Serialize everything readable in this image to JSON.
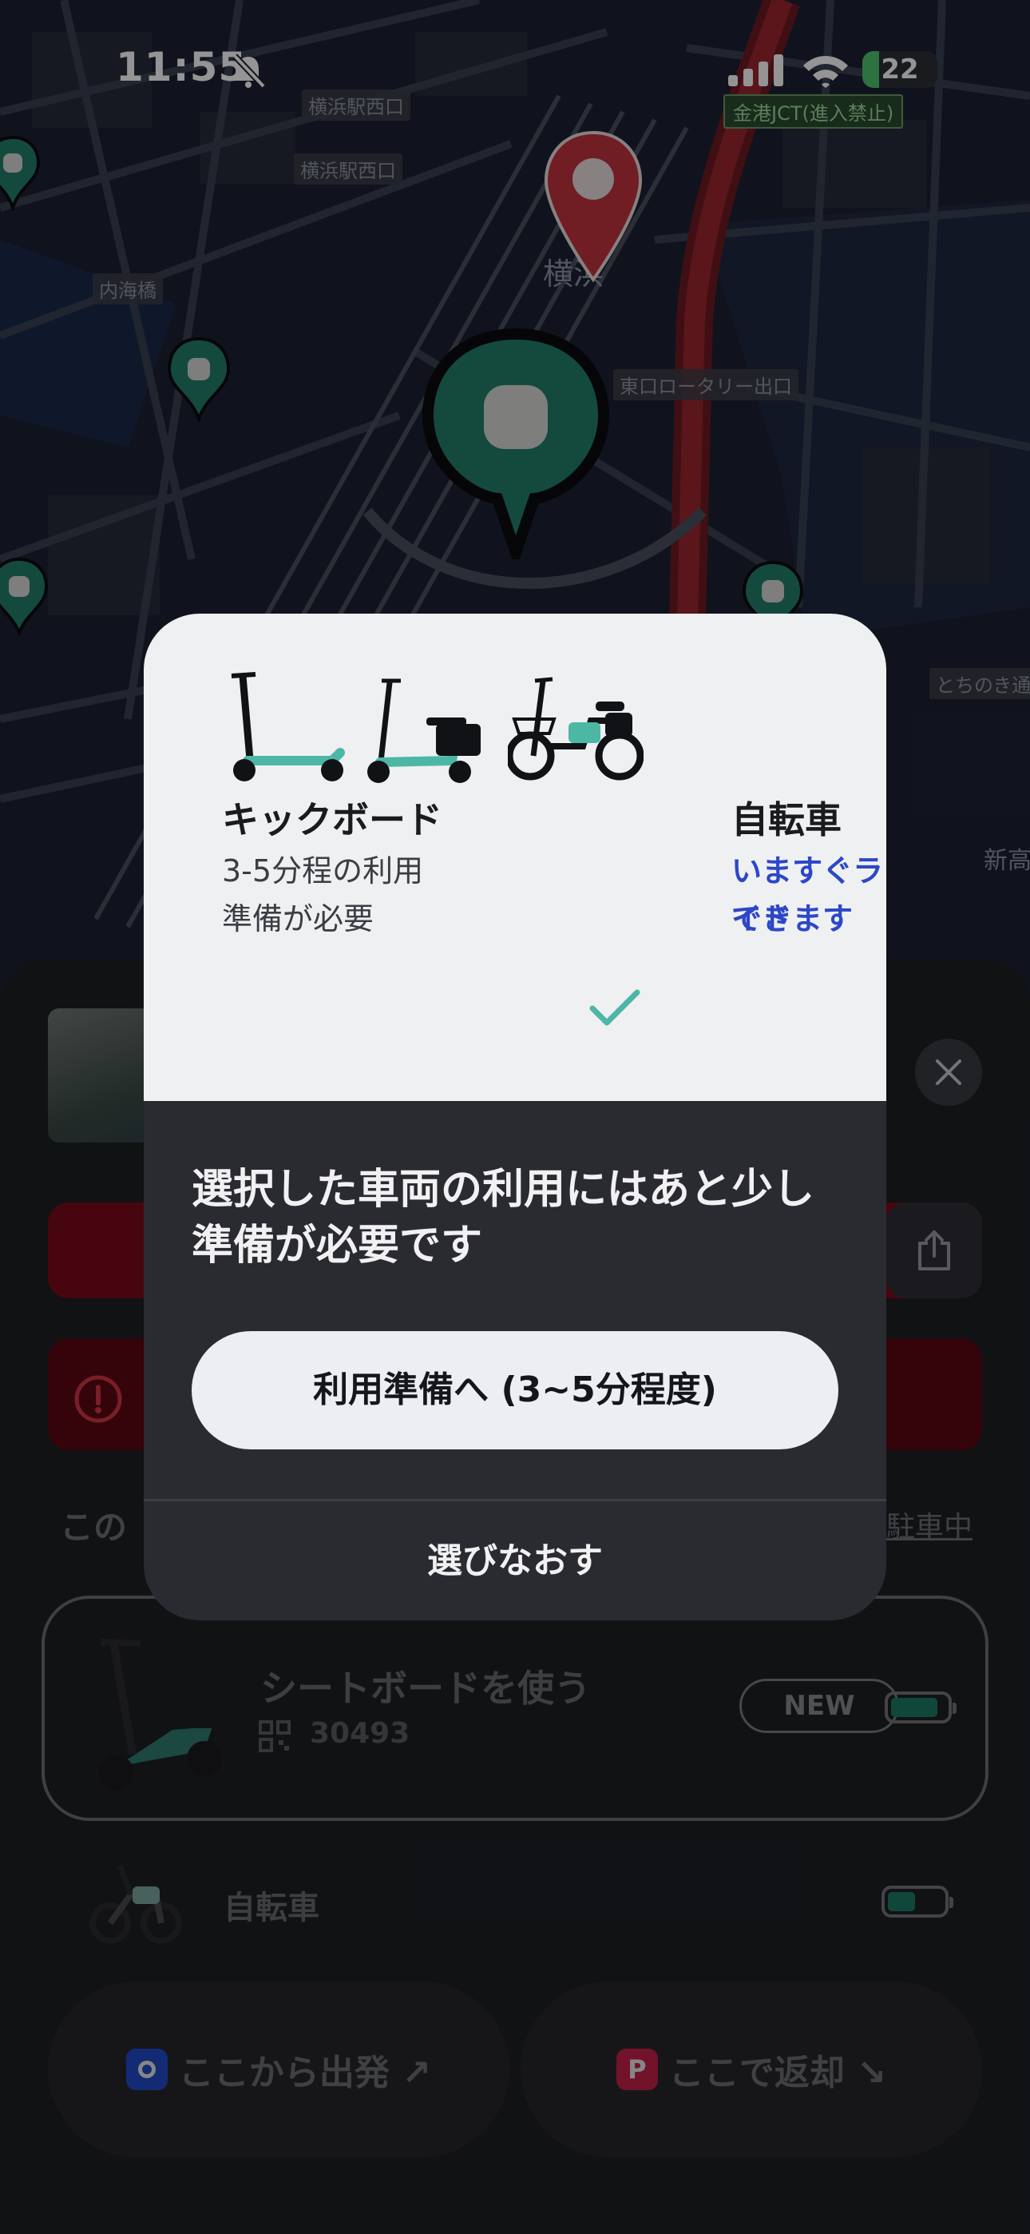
{
  "status_bar": {
    "time": "11:55",
    "battery": "22",
    "battery_level": 0.22,
    "battery_color": "#4fc46d"
  },
  "map": {
    "labels": {
      "yokohama_west_1": "横浜駅西口",
      "yokohama_west_2": "横浜駅西口",
      "naikaibashi": "内海橋",
      "east_rotary": "東口ロータリー出口",
      "jct": "金港JCT(進入禁止)",
      "shin": "新高",
      "tochinoki": "とちのき通",
      "yokohama": "横浜"
    },
    "colors": {
      "accent": "#24806b",
      "pin_red": "#c2323f"
    }
  },
  "sheet": {
    "section_title": "この",
    "parked_link": "駐車中",
    "vehicle": {
      "title": "シートボードを使う",
      "code": "30493",
      "badge": "NEW",
      "battery_level": 0.85
    },
    "bicycle_label": "自転車",
    "bicycle_battery_level": 0.5,
    "depart": {
      "badge": "",
      "label": "ここから出発 ↗",
      "color": "#1f4bc9"
    },
    "return": {
      "badge": "P",
      "label": "ここで返却 ↘",
      "color": "#c4204a"
    }
  },
  "modal": {
    "kickboard": {
      "title": "キックボード",
      "desc_line1": "3-5分程の利用",
      "desc_line2": "準備が必要"
    },
    "bicycle": {
      "title": "自転車",
      "desc_line1": "いますぐライド",
      "desc_line2": "できます",
      "selected": true
    },
    "message": "選択した車両の利用にはあと少し準備が必要です",
    "primary_button": "利用準備へ (3~5分程度)",
    "secondary_button": "選びなおす",
    "accent": "#4db7a6"
  }
}
